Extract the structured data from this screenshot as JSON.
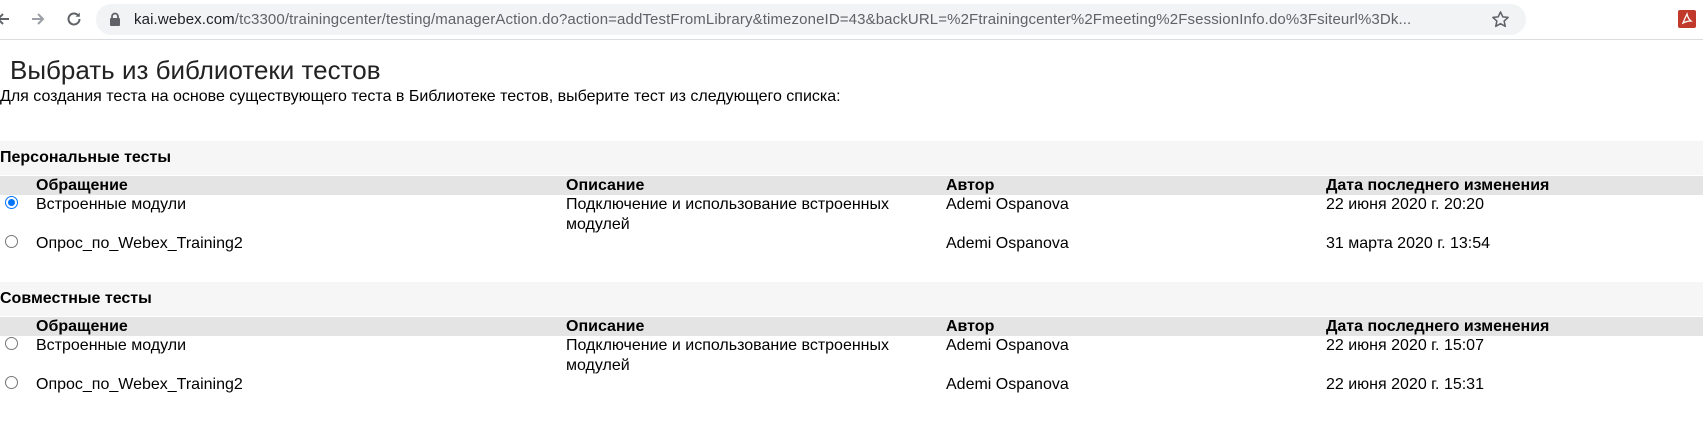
{
  "browser": {
    "url_host": "kai.webex.com",
    "url_rest": "/tc3300/trainingcenter/testing/managerAction.do?action=addTestFromLibrary&timezoneID=43&backURL=%2Ftrainingcenter%2Fmeeting%2FsessionInfo.do%3Fsiteurl%3Dk..."
  },
  "page": {
    "title": "Выбрать из библиотеки тестов",
    "intro": "Для создания теста на основе существующего теста в Библиотеке тестов, выберите тест из следующего списка:"
  },
  "columns": {
    "name": "Обращение",
    "description": "Описание",
    "author": "Автор",
    "modified": "Дата последнего изменения"
  },
  "sections": [
    {
      "title": "Персональные тесты",
      "rows": [
        {
          "name": "Встроенные модули",
          "description": "Подключение и использование встроенных модулей",
          "author": "Ademi Ospanova",
          "modified": "22 июня 2020 г. 20:20",
          "selected": true
        },
        {
          "name": "Опрос_по_Webex_Training2",
          "description": "",
          "author": "Ademi Ospanova",
          "modified": "31 марта 2020 г. 13:54",
          "selected": false
        }
      ]
    },
    {
      "title": "Совместные тесты",
      "rows": [
        {
          "name": "Встроенные модули",
          "description": "Подключение и использование встроенных модулей",
          "author": "Ademi Ospanova",
          "modified": "22 июня 2020 г. 15:07",
          "selected": false
        },
        {
          "name": "Опрос_по_Webex_Training2",
          "description": "",
          "author": "Ademi Ospanova",
          "modified": "22 июня 2020 г. 15:31",
          "selected": false
        }
      ]
    }
  ],
  "icons": {
    "back": "arrow-left-icon",
    "forward": "arrow-right-icon",
    "reload": "reload-icon",
    "lock": "lock-icon",
    "bookmark": "star-icon",
    "extension": "pdf-extension-icon"
  },
  "colors": {
    "radio_accent": "#0075ff",
    "section_bg": "#f6f6f6",
    "header_bg": "#e4e4e4"
  }
}
